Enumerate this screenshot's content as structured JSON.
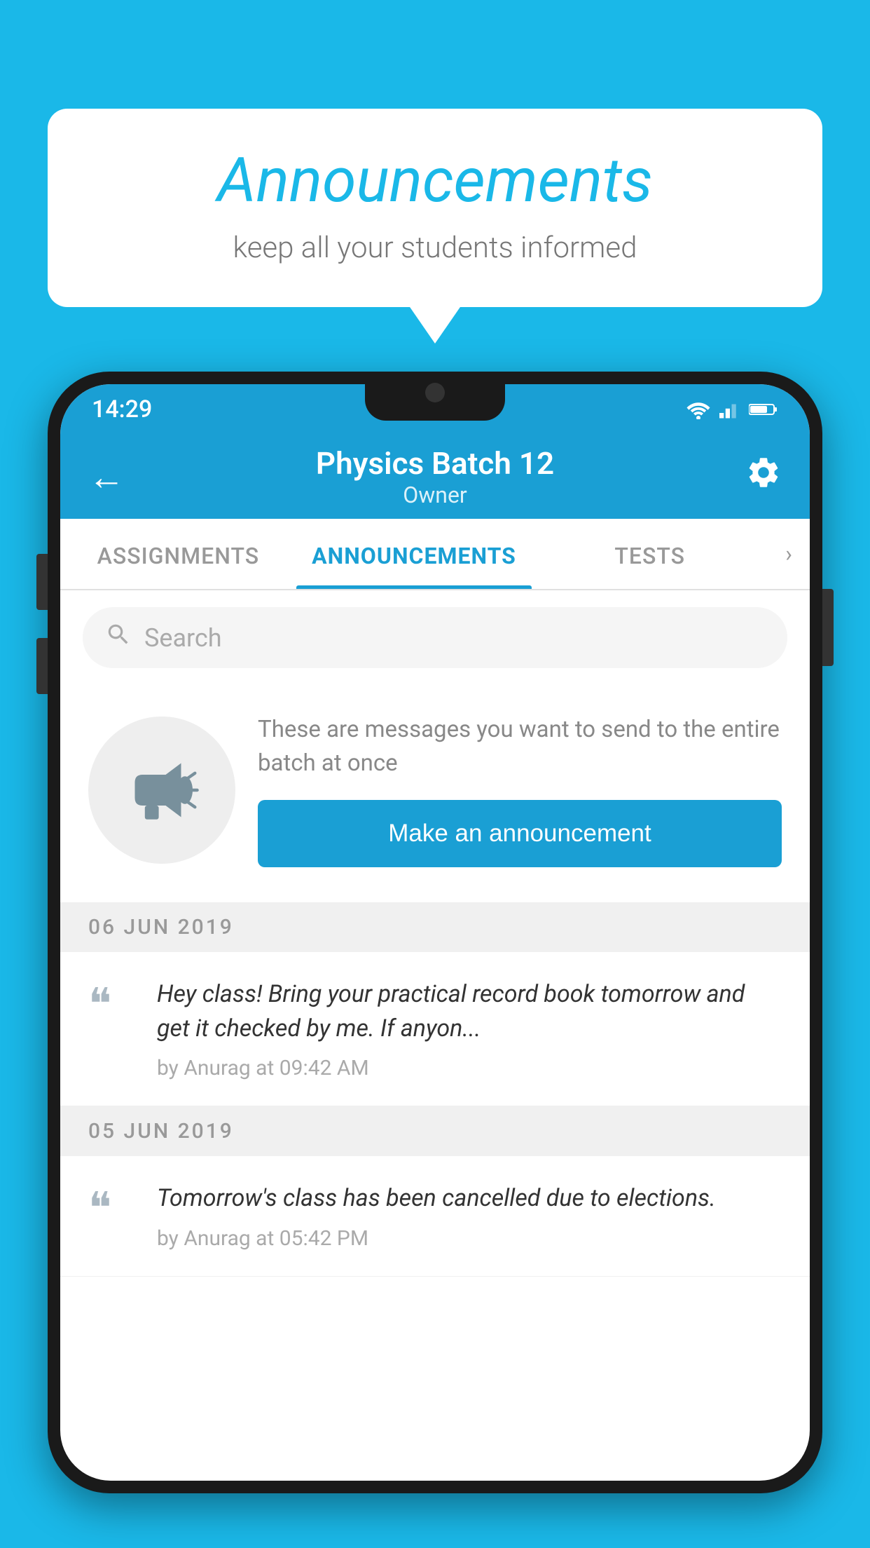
{
  "background_color": "#1ab8e8",
  "speech_bubble": {
    "title": "Announcements",
    "subtitle": "keep all your students informed"
  },
  "phone": {
    "status_bar": {
      "time": "14:29"
    },
    "app_bar": {
      "back_icon": "←",
      "title": "Physics Batch 12",
      "subtitle": "Owner",
      "settings_icon": "⚙"
    },
    "tabs": [
      {
        "label": "ASSIGNMENTS",
        "active": false
      },
      {
        "label": "ANNOUNCEMENTS",
        "active": true
      },
      {
        "label": "TESTS",
        "active": false
      }
    ],
    "search": {
      "placeholder": "Search"
    },
    "promo": {
      "description": "These are messages you want to send to the entire batch at once",
      "button_label": "Make an announcement"
    },
    "announcements": [
      {
        "date": "06  JUN  2019",
        "items": [
          {
            "text": "Hey class! Bring your practical record book tomorrow and get it checked by me. If anyon...",
            "meta": "by Anurag at 09:42 AM"
          }
        ]
      },
      {
        "date": "05  JUN  2019",
        "items": [
          {
            "text": "Tomorrow's class has been cancelled due to elections.",
            "meta": "by Anurag at 05:42 PM"
          }
        ]
      }
    ]
  }
}
